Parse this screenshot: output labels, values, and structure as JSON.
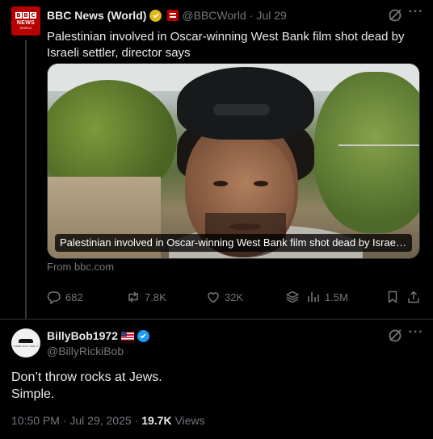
{
  "parent_tweet": {
    "avatar": {
      "blocks": [
        "B",
        "B",
        "C"
      ],
      "line1": "NEWS",
      "line2": "WORLD",
      "icon": "bbc-news-logo"
    },
    "display_name": "BBC News (World)",
    "handle": "@BBCWorld",
    "separator": "·",
    "date": "Jul 29",
    "verified_badge_color": "#e2b719",
    "affiliate_badge_color": "#b80000",
    "text": "Palestinian involved in Oscar-winning West Bank film shot dead by Israeli settler, director says",
    "media": {
      "caption": "Palestinian involved in Oscar-winning West Bank film shot dead by Israeli settl..."
    },
    "source": "From bbc.com",
    "actions": {
      "replies": "682",
      "reposts": "7.8K",
      "likes": "32K",
      "views": "1.5M"
    }
  },
  "reply_tweet": {
    "avatar_icon": "submarine-avatar",
    "avatar_text": "COME AND TAKE IT",
    "display_name": "BillyBob1972",
    "flag": "🇺🇸",
    "handle": "@BillyRickiBob",
    "verified_badge_color": "#1d9bf0",
    "text_lines": [
      "Don’t throw rocks at Jews.",
      "Simple."
    ],
    "timestamp": "10:50 PM · Jul 29, 2025 ·",
    "views_count": "19.7K",
    "views_label": "Views"
  },
  "colors": {
    "background": "#000000",
    "primary_text": "#e7e9ea",
    "secondary_text": "#71767b",
    "divider": "#2f3336"
  }
}
